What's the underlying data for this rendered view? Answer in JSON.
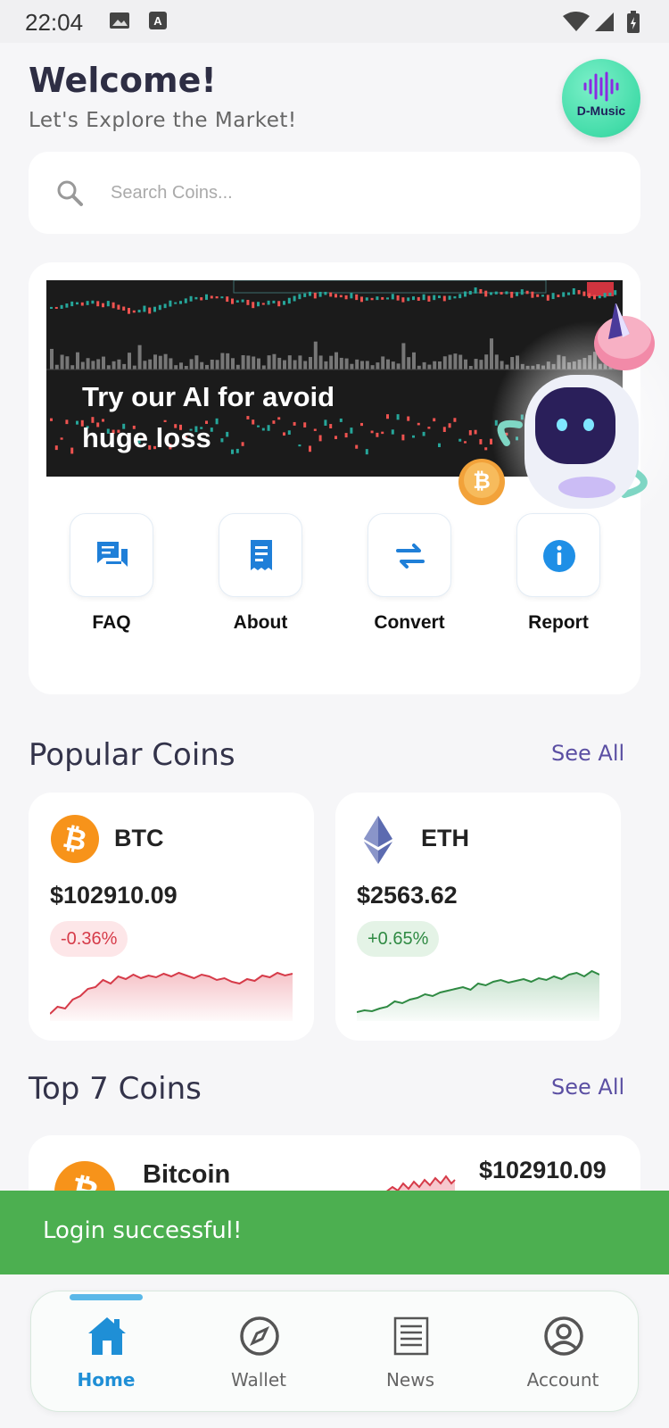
{
  "status_bar": {
    "time": "22:04"
  },
  "header": {
    "title": "Welcome!",
    "subtitle": "Let's Explore the Market!",
    "logo_text": "D-Music"
  },
  "search": {
    "placeholder": "Search Coins..."
  },
  "banner": {
    "text": "Try our AI for avoid huge loss"
  },
  "actions": [
    {
      "label": "FAQ",
      "icon": "chat-icon"
    },
    {
      "label": "About",
      "icon": "receipt-icon"
    },
    {
      "label": "Convert",
      "icon": "swap-icon"
    },
    {
      "label": "Report",
      "icon": "info-icon"
    }
  ],
  "popular": {
    "title": "Popular Coins",
    "see_all": "See All",
    "coins": [
      {
        "symbol": "BTC",
        "price": "$102910.09",
        "change": "-0.36%",
        "color": "#d63b49"
      },
      {
        "symbol": "ETH",
        "price": "$2563.62",
        "change": "+0.65%",
        "color": "#2f8a43"
      }
    ]
  },
  "top": {
    "title": "Top 7 Coins",
    "see_all": "See All",
    "first": {
      "name": "Bitcoin",
      "price": "$102910.09"
    }
  },
  "snackbar": {
    "text": "Login successful!"
  },
  "nav": {
    "items": [
      {
        "label": "Home",
        "icon": "home-icon",
        "active": true
      },
      {
        "label": "Wallet",
        "icon": "compass-icon",
        "active": false
      },
      {
        "label": "News",
        "icon": "newspaper-icon",
        "active": false
      },
      {
        "label": "Account",
        "icon": "account-icon",
        "active": false
      }
    ]
  },
  "colors": {
    "accent": "#1f8fd6",
    "success": "#4caf50",
    "brand_purple": "#5b4fa3"
  }
}
